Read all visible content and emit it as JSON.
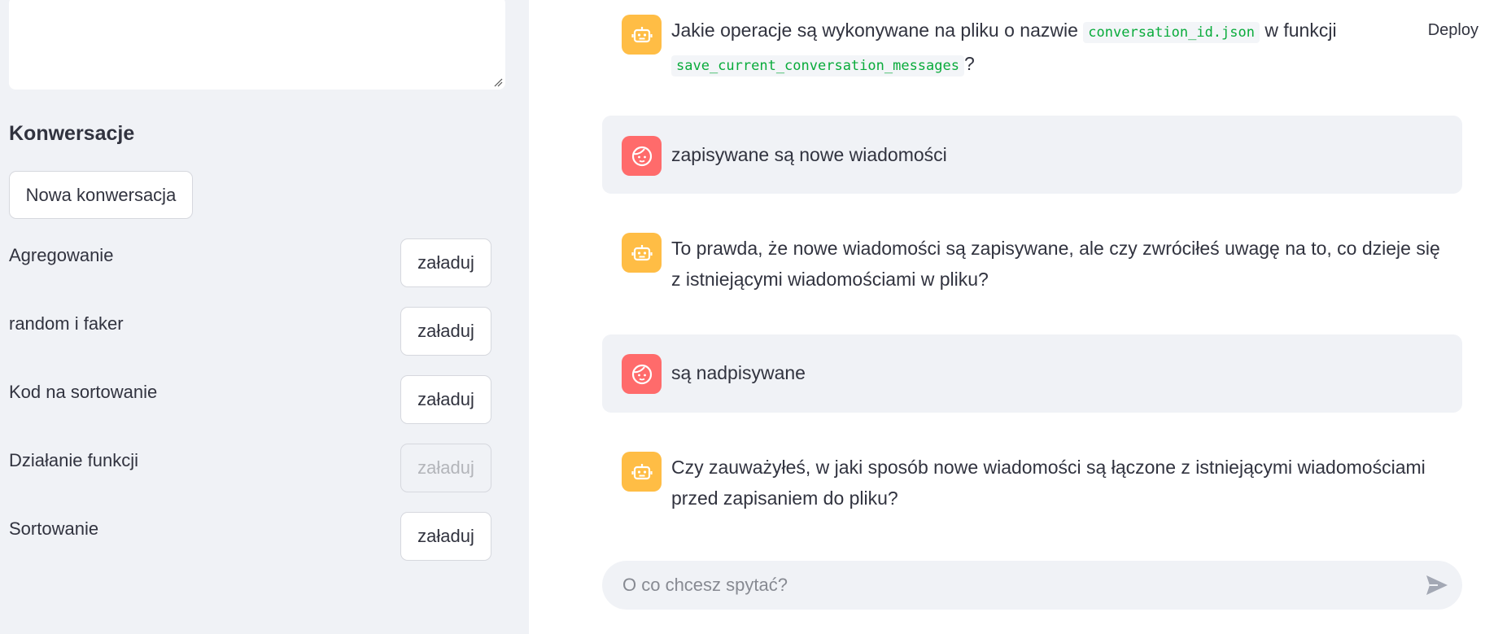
{
  "sidebar": {
    "heading": "Konwersacje",
    "new_conversation_label": "Nowa konwersacja",
    "conversations": [
      {
        "title": "Agregowanie",
        "load_label": "załaduj",
        "disabled": false
      },
      {
        "title": "random i faker",
        "load_label": "załaduj",
        "disabled": false
      },
      {
        "title": "Kod na sortowanie",
        "load_label": "załaduj",
        "disabled": false
      },
      {
        "title": "Działanie funkcji",
        "load_label": "załaduj",
        "disabled": true
      },
      {
        "title": "Sortowanie",
        "load_label": "załaduj",
        "disabled": false
      }
    ]
  },
  "header": {
    "deploy_label": "Deploy"
  },
  "messages": [
    {
      "role": "assistant",
      "avatar_icon": "robot-icon",
      "parts": {
        "t1": "Jakie operacje są wykonywane na pliku o nazwie",
        "code1": "conversation_id.json",
        "t2": "w funkcji",
        "code2": "save_current_conversation_messages",
        "t3": "?"
      }
    },
    {
      "role": "user",
      "avatar_icon": "user-face-icon",
      "text": "zapisywane są nowe wiadomości"
    },
    {
      "role": "assistant",
      "avatar_icon": "robot-icon",
      "text": "To prawda, że nowe wiadomości są zapisywane, ale czy zwróciłeś uwagę na to, co dzieje się z istniejącymi wiadomościami w pliku?"
    },
    {
      "role": "user",
      "avatar_icon": "user-face-icon",
      "text": "są nadpisywane"
    },
    {
      "role": "assistant",
      "avatar_icon": "robot-icon",
      "text": "Czy zauważyłeś, w jaki sposób nowe wiadomości są łączone z istniejącymi wiadomościami przed zapisaniem do pliku?"
    }
  ],
  "chat_input": {
    "placeholder": "O co chcesz spytać?",
    "send_icon": "send-icon"
  },
  "colors": {
    "sidebar_bg": "#f0f2f6",
    "bot_avatar": "#ffbd45",
    "user_avatar": "#ff6b6b",
    "code_text": "#09ab3b",
    "text": "#31333f"
  }
}
